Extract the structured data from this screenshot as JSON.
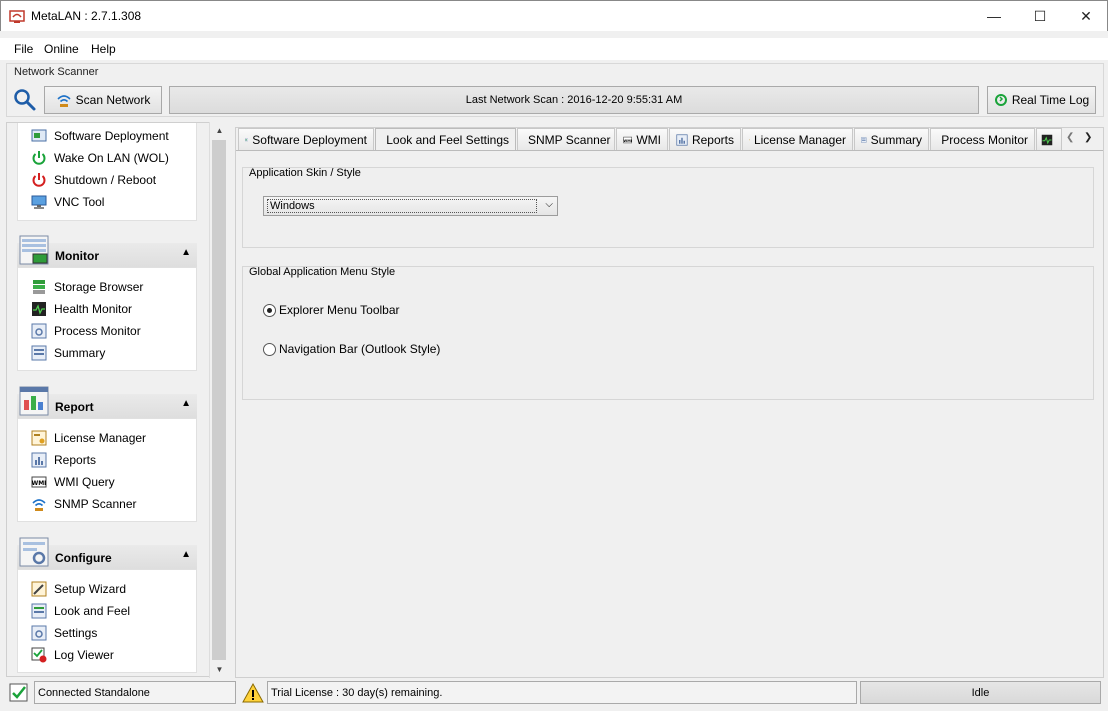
{
  "window": {
    "title": "MetaLAN : 2.7.1.308"
  },
  "menu": [
    "File",
    "Online",
    "Help"
  ],
  "scanner": {
    "group_label": "Network Scanner",
    "scan_button": "Scan Network",
    "last_scan": "Last Network Scan : 2016-12-20 9:55:31 AM",
    "log_button": "Real Time Log"
  },
  "sidebar": {
    "top_items": [
      "Software Deployment",
      "Wake On LAN (WOL)",
      "Shutdown / Reboot",
      "VNC Tool"
    ],
    "monitor": {
      "title": "Monitor",
      "items": [
        "Storage Browser",
        "Health Monitor",
        "Process Monitor",
        "Summary"
      ]
    },
    "report": {
      "title": "Report",
      "items": [
        "License Manager",
        "Reports",
        "WMI Query",
        "SNMP Scanner"
      ]
    },
    "configure": {
      "title": "Configure",
      "items": [
        "Setup Wizard",
        "Look and Feel",
        "Settings",
        "Log Viewer"
      ]
    }
  },
  "tabs": [
    "Software Deployment",
    "Look and Feel Settings",
    "SNMP Scanner",
    "WMI",
    "Reports",
    "License Manager",
    "Summary",
    "Process Monitor"
  ],
  "active_tab": "Look and Feel Settings",
  "skin": {
    "label": "Application Skin / Style",
    "selected": "Windows"
  },
  "menu_style": {
    "label": "Global Application Menu Style",
    "options": [
      "Explorer Menu Toolbar",
      "Navigation Bar (Outlook Style)"
    ],
    "selected": "Explorer Menu Toolbar"
  },
  "status": {
    "connection": "Connected Standalone",
    "license": "Trial License : 30 day(s) remaining.",
    "state": "Idle"
  },
  "colors": {
    "accent_blue": "#1e72c8",
    "power_green": "#1aa33a",
    "power_red": "#d42020"
  }
}
